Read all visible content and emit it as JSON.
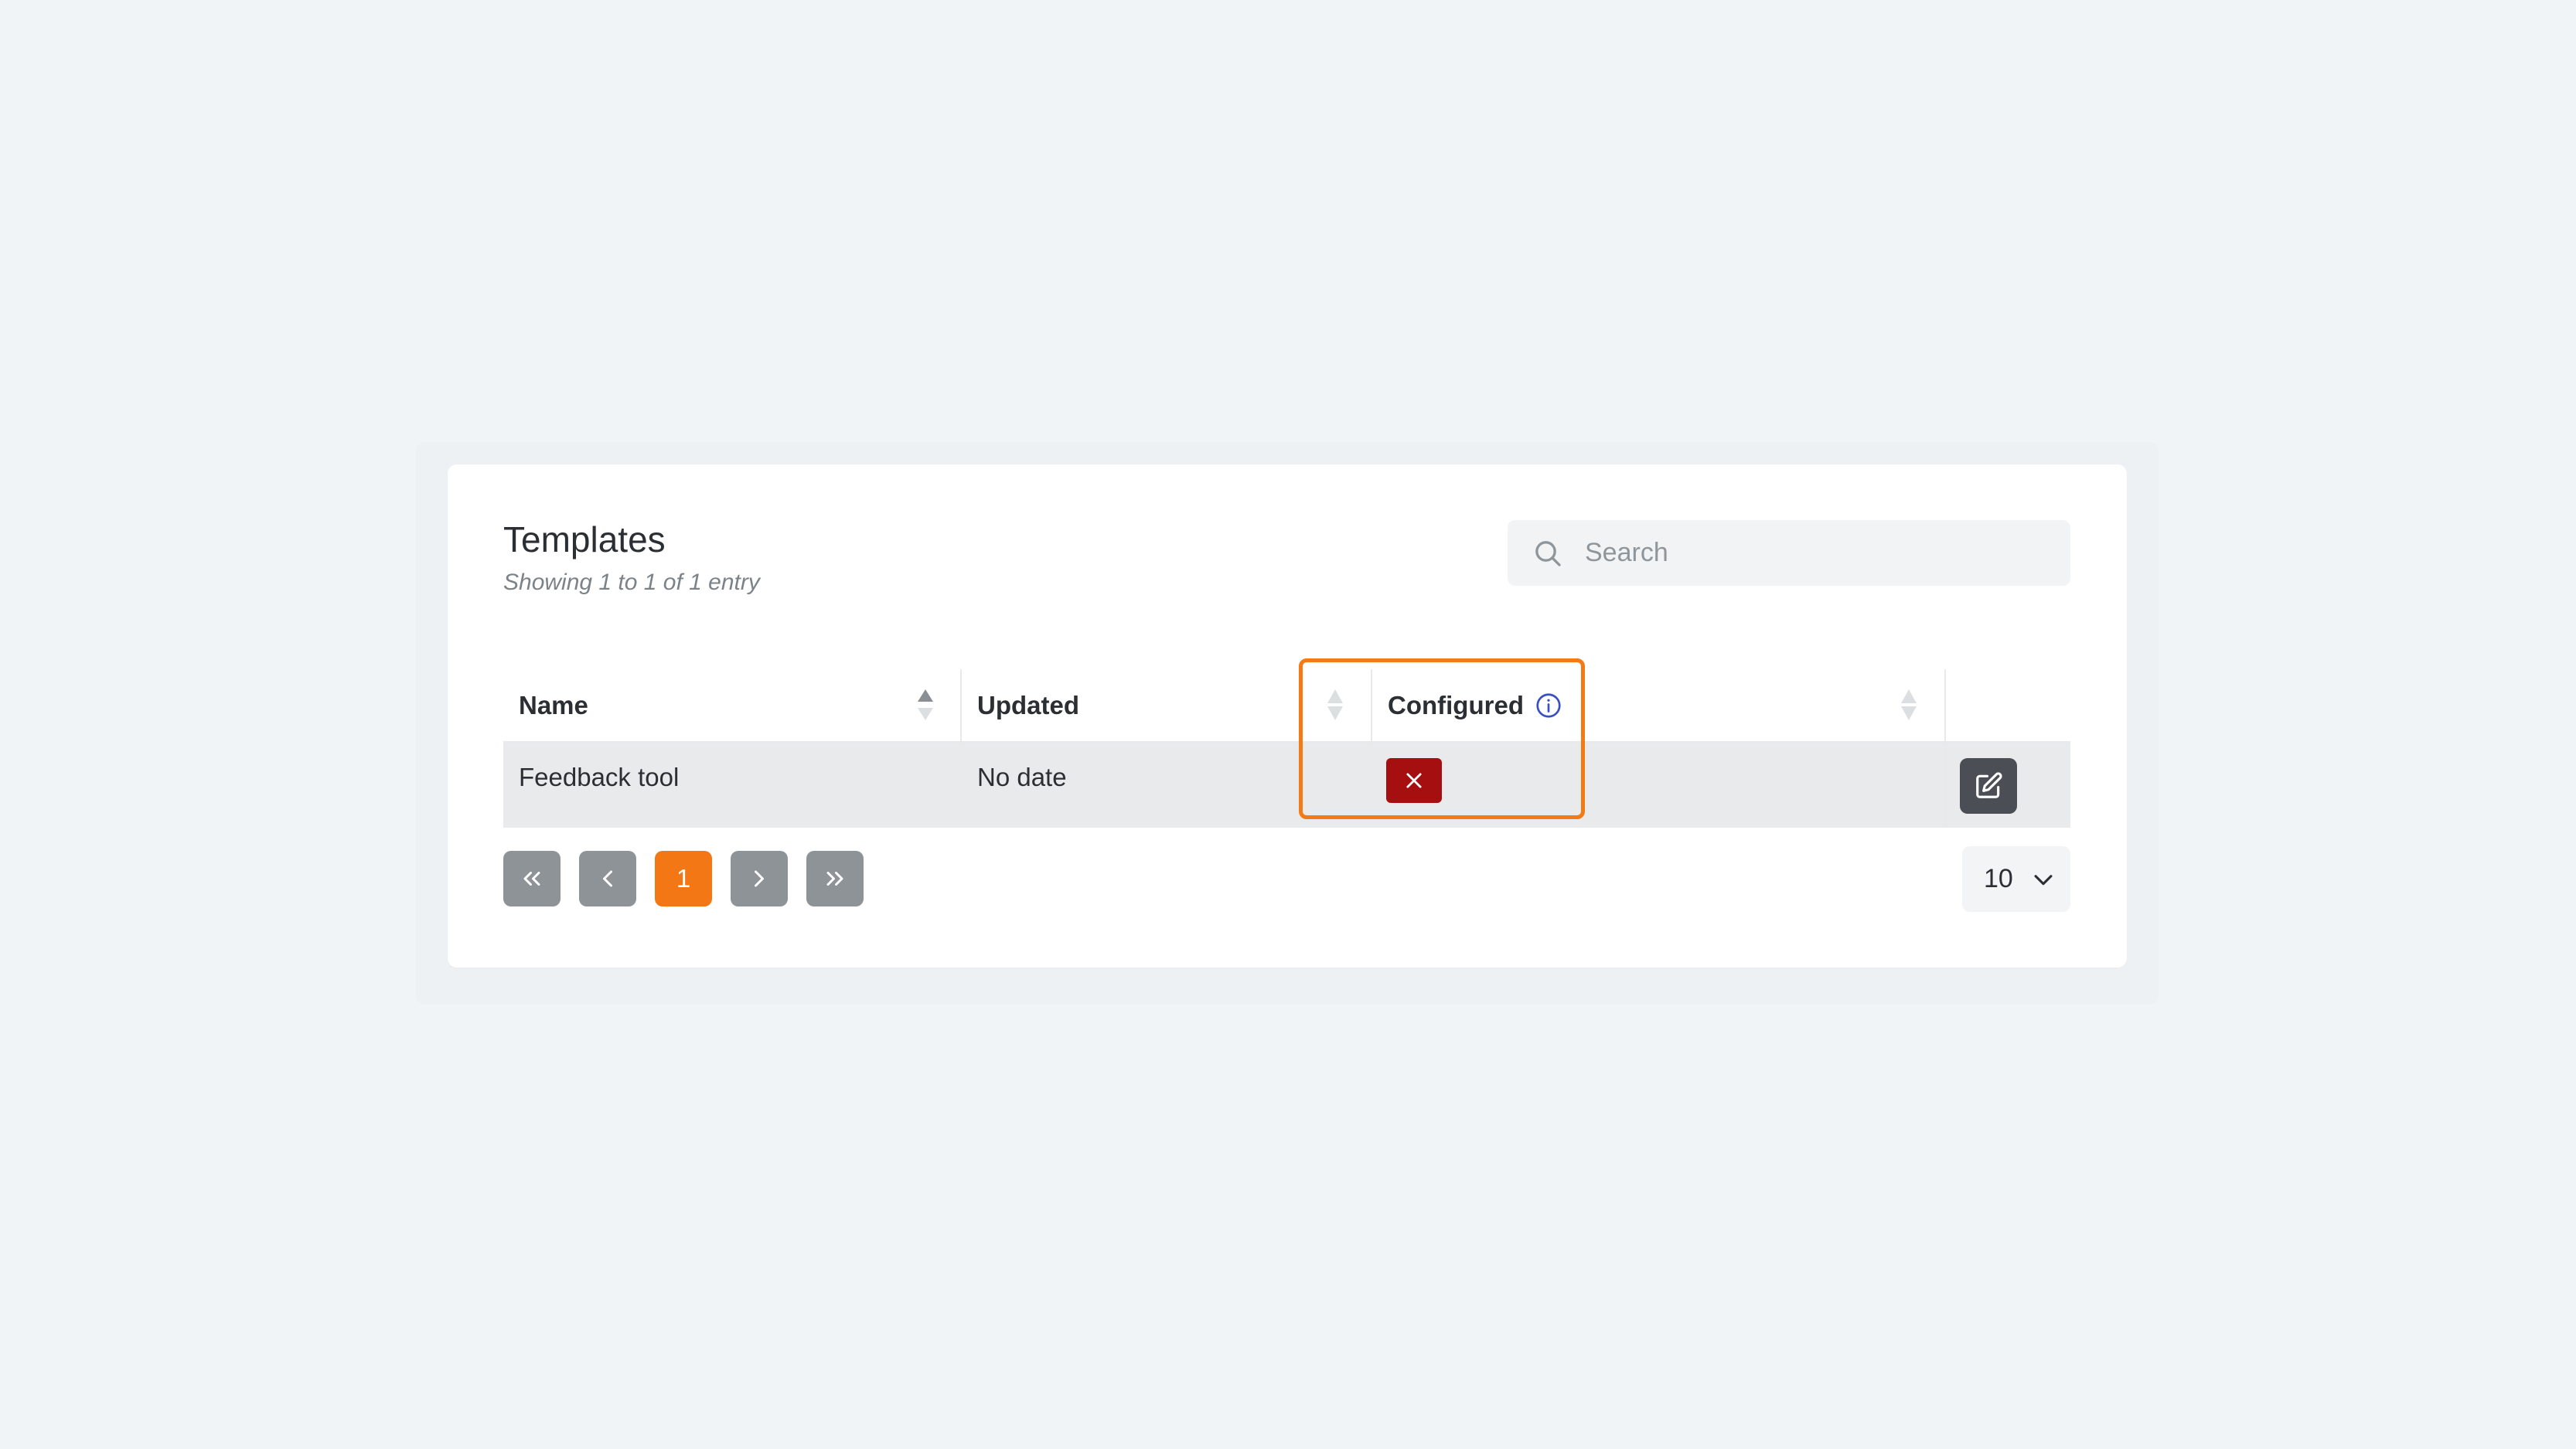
{
  "header": {
    "title": "Templates",
    "subtitle": "Showing 1 to 1 of 1 entry"
  },
  "search": {
    "placeholder": "Search",
    "icon": "search-icon"
  },
  "table": {
    "columns": [
      {
        "label": "Name",
        "sort": "ascending"
      },
      {
        "label": "Updated",
        "sort": "none"
      },
      {
        "label": "Configured",
        "sort": "none",
        "info_icon": "info-icon"
      },
      {
        "label": "",
        "sort": "none"
      }
    ],
    "rows": [
      {
        "name": "Feedback tool",
        "updated": "No date",
        "configured": false,
        "configured_icon": "close-icon",
        "action_icon": "edit-icon"
      }
    ]
  },
  "pagination": {
    "first_icon": "chevrons-left-icon",
    "prev_icon": "chevron-left-icon",
    "current_page": "1",
    "next_icon": "chevron-right-icon",
    "last_icon": "chevrons-right-icon"
  },
  "page_size": {
    "value": "10",
    "icon": "chevron-down-icon"
  },
  "colors": {
    "accent": "#f47716",
    "highlight_border": "#f47a16",
    "danger": "#a50f0f",
    "info": "#3b4fc4",
    "button_gray": "#8e9398",
    "edit_button": "#4b4f55"
  }
}
